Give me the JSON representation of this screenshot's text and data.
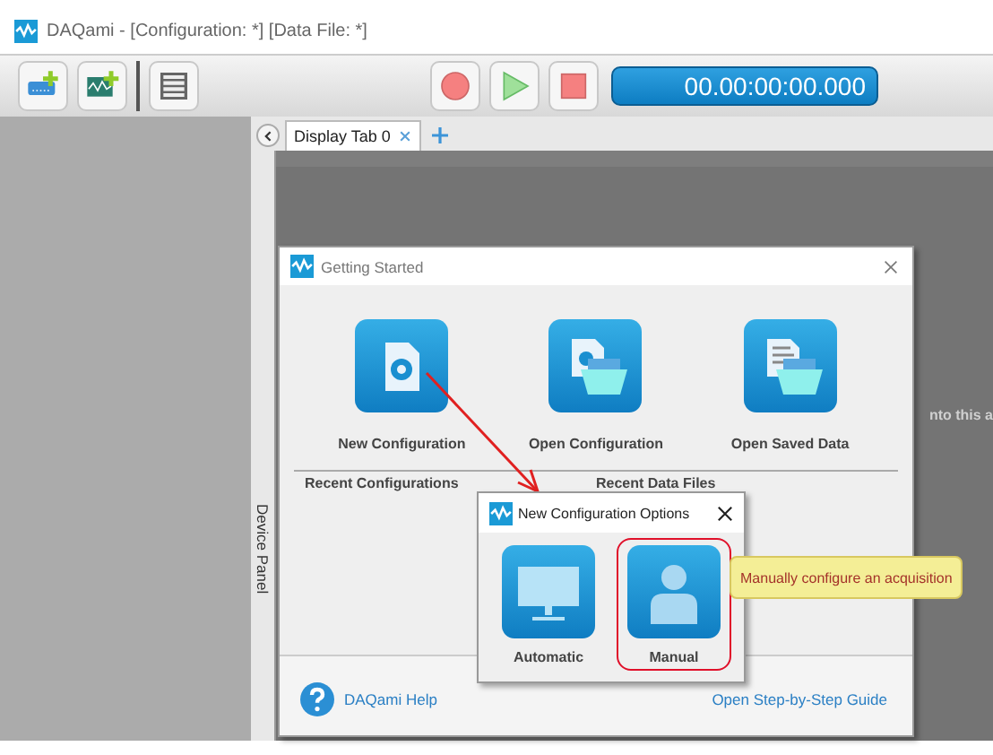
{
  "window": {
    "title": "DAQami - [Configuration: *] [Data File: *]"
  },
  "timer": "00.00:00:00.000",
  "tabs": [
    {
      "label": "Display Tab 0",
      "selected": true
    }
  ],
  "device_panel": {
    "label": "Device Panel"
  },
  "display_area": {
    "hint": "nto this a"
  },
  "getting_started": {
    "title": "Getting Started",
    "actions": [
      {
        "label": "New Configuration",
        "kind": "new"
      },
      {
        "label": "Open Configuration",
        "kind": "open-config"
      },
      {
        "label": "Open Saved Data",
        "kind": "open-data"
      }
    ],
    "recent_configurations": "Recent Configurations",
    "recent_data_files": "Recent Data Files",
    "help_link": "DAQami Help",
    "guide_link": "Open Step-by-Step Guide"
  },
  "new_config_options": {
    "title": "New Configuration Options",
    "options": [
      {
        "label": "Automatic",
        "kind": "automatic",
        "highlighted": false
      },
      {
        "label": "Manual",
        "kind": "manual",
        "highlighted": true
      }
    ],
    "tooltip": "Manually configure an acquisition"
  }
}
